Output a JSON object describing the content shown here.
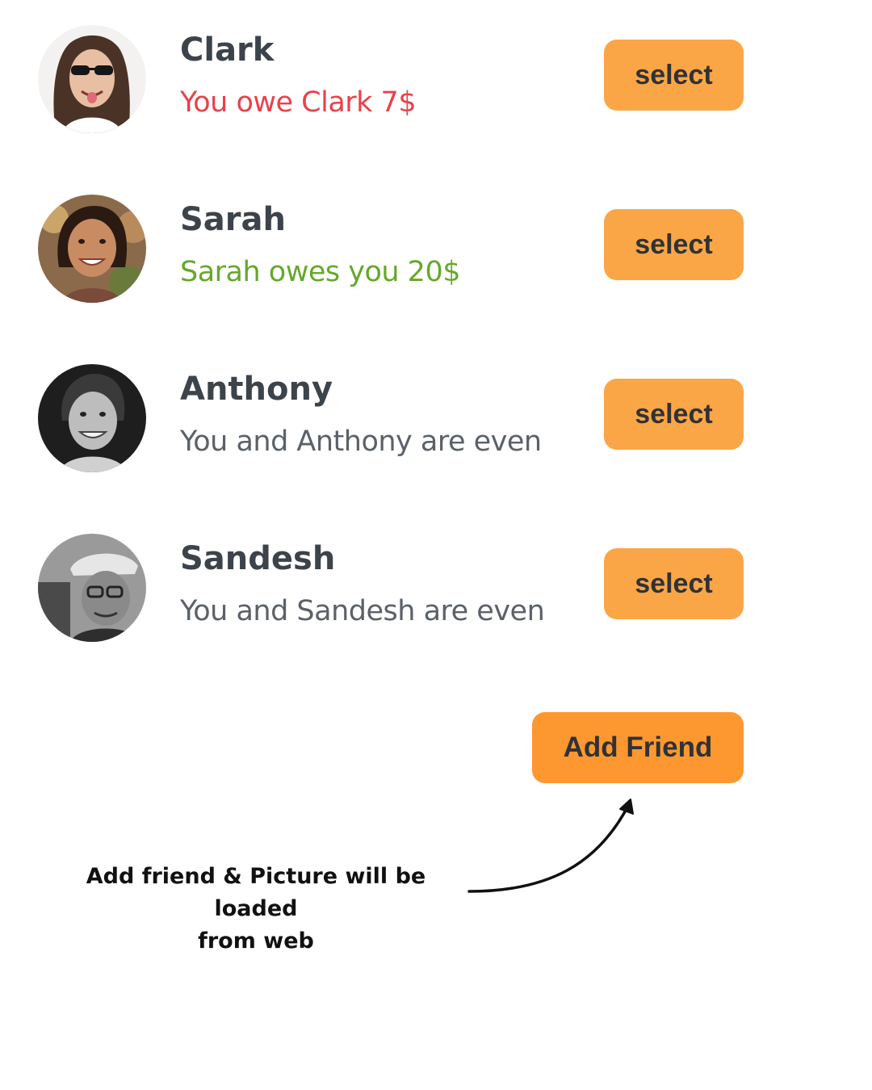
{
  "friends": [
    {
      "name": "Clark",
      "status": "You owe Clark 7$",
      "status_type": "owe",
      "button_label": "select"
    },
    {
      "name": "Sarah",
      "status": "Sarah owes you 20$",
      "status_type": "owed",
      "button_label": "select"
    },
    {
      "name": "Anthony",
      "status": "You and Anthony are even",
      "status_type": "even",
      "button_label": "select"
    },
    {
      "name": "Sandesh",
      "status": "You and Sandesh are even",
      "status_type": "even",
      "button_label": "select"
    }
  ],
  "add_friend_button": "Add Friend",
  "annotation": {
    "line1": "Add friend & Picture will be loaded",
    "line2": "from web"
  },
  "colors": {
    "button": "#fba646",
    "add_friend_button": "#fc982f",
    "owe": "#e8424a",
    "owed": "#66a82b",
    "even": "#5b6169",
    "name": "#3d434b"
  }
}
